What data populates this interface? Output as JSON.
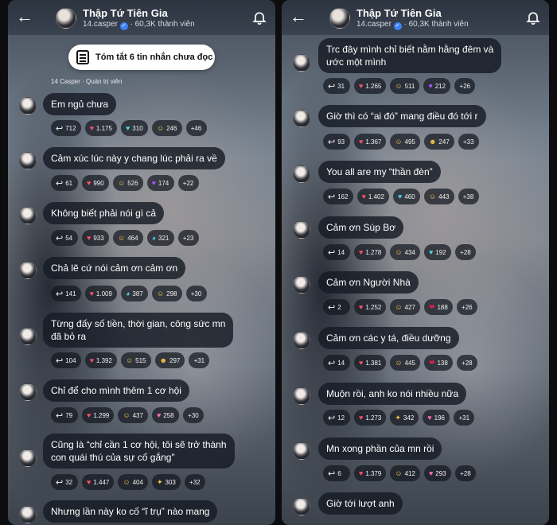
{
  "panels": [
    {
      "title": "Thập Tứ Tiên Gia",
      "handle": "14.casper",
      "members": "60,3K thành viên",
      "summary": "Tóm tắt 6 tin nhắn chưa đọc",
      "author": "14 Casper · Quản trị viên",
      "messages": [
        {
          "lines": [
            "Em ngủ chưa"
          ],
          "reacts": [
            "712",
            "1.175",
            "310",
            "246",
            "+46"
          ]
        },
        {
          "lines": [
            "Cảm xúc lúc này y chang lúc phải ra về"
          ],
          "reacts": [
            "61",
            "990",
            "526",
            "174",
            "+22"
          ]
        },
        {
          "lines": [
            "Không biết phải nói gì cả"
          ],
          "reacts": [
            "54",
            "933",
            "464",
            "321",
            "+23"
          ]
        },
        {
          "lines": [
            "Chả lẽ cứ nói cảm ơn cảm ơn"
          ],
          "reacts": [
            "141",
            "1.009",
            "387",
            "298",
            "+30"
          ]
        },
        {
          "lines": [
            "Từng đấy số tiền, thời gian, công sức mn",
            "đã bỏ ra"
          ],
          "reacts": [
            "104",
            "1.392",
            "515",
            "297",
            "+31"
          ]
        },
        {
          "lines": [
            "Chỉ để cho mình thêm 1 cơ hội"
          ],
          "reacts": [
            "79",
            "1.299",
            "437",
            "258",
            "+30"
          ]
        },
        {
          "lines": [
            "Cũng là “chỉ cần 1 cơ hội, tôi sẽ trở thành",
            "con quái thú của sự cố gắng”"
          ],
          "reacts": [
            "32",
            "1.447",
            "404",
            "303",
            "+32"
          ]
        },
        {
          "lines": [
            "Nhưng lần này ko cố “ĩ trụ” nào mang"
          ],
          "reacts": []
        }
      ]
    },
    {
      "title": "Thập Tứ Tiên Gia",
      "handle": "14.casper",
      "members": "60,3K thành viên",
      "messages": [
        {
          "lines": [
            "Trc đây mình chỉ biết nằm hằng đêm và",
            "ước một mình"
          ],
          "reacts": [
            "31",
            "1.265",
            "511",
            "212",
            "+26"
          ]
        },
        {
          "lines": [
            "Giờ thì có “ai đó” mang điều đó tới r"
          ],
          "reacts": [
            "93",
            "1.367",
            "495",
            "247",
            "+33"
          ]
        },
        {
          "lines": [
            "You all are my “thần đèn”"
          ],
          "reacts": [
            "162",
            "1.402",
            "460",
            "443",
            "+38"
          ]
        },
        {
          "lines": [
            "Cảm ơn Súp Bơ"
          ],
          "reacts": [
            "14",
            "1.278",
            "434",
            "192",
            "+28"
          ]
        },
        {
          "lines": [
            "Cảm ơn Người Nhà"
          ],
          "reacts": [
            "2",
            "1.252",
            "427",
            "188",
            "+26"
          ]
        },
        {
          "lines": [
            "Cảm ơn các y tá, điều dưỡng"
          ],
          "reacts": [
            "14",
            "1.381",
            "445",
            "138",
            "+28"
          ]
        },
        {
          "lines": [
            "Muộn rồi, anh ko nói nhiều nữa"
          ],
          "reacts": [
            "12",
            "1.273",
            "342",
            "196",
            "+31"
          ]
        },
        {
          "lines": [
            "Mn xong phần của mn rồi"
          ],
          "reacts": [
            "6",
            "1.379",
            "412",
            "293",
            "+28"
          ]
        },
        {
          "lines": [
            "Giờ tới lượt anh"
          ],
          "reacts": []
        }
      ]
    }
  ],
  "icons": {
    "reply": "reply-arrow-icon",
    "heart": "heart-icon",
    "emoji": "smile-icon",
    "back": "back-arrow-icon",
    "bell": "bell-icon",
    "summary": "summary-doc-icon"
  }
}
